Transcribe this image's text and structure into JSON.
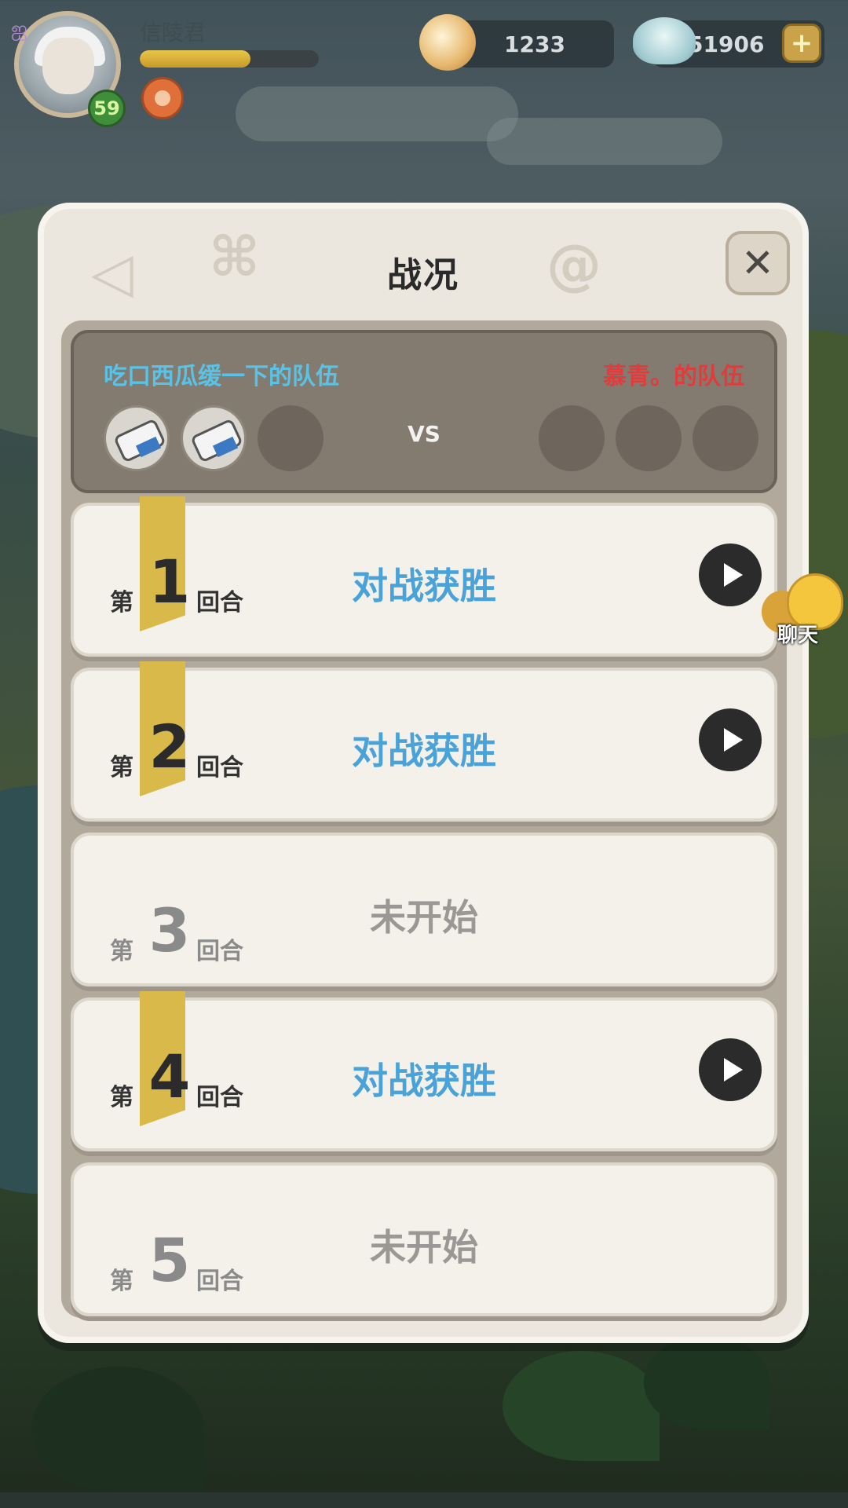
{
  "player": {
    "name": "信陵君",
    "level": "59",
    "exp_fraction": 0.62
  },
  "resources": {
    "pearls": "1233",
    "shells": "251906",
    "add_label": "+"
  },
  "dialog": {
    "title": "战况",
    "close_label": "✕",
    "team_left": "吃口西瓜缓一下的队伍",
    "team_right": "慕青。的队伍",
    "vs_label": "VS",
    "rounds": [
      {
        "prefix": "第",
        "number": "1",
        "suffix": "回合",
        "status": "对战获胜",
        "state": "won"
      },
      {
        "prefix": "第",
        "number": "2",
        "suffix": "回合",
        "status": "对战获胜",
        "state": "won"
      },
      {
        "prefix": "第",
        "number": "3",
        "suffix": "回合",
        "status": "未开始",
        "state": "pending"
      },
      {
        "prefix": "第",
        "number": "4",
        "suffix": "回合",
        "status": "对战获胜",
        "state": "won"
      },
      {
        "prefix": "第",
        "number": "5",
        "suffix": "回合",
        "status": "未开始",
        "state": "pending"
      }
    ]
  },
  "chat": {
    "label": "聊天"
  },
  "colors": {
    "win_text": "#4aa3d8",
    "pending_text": "#9a9894",
    "team_left": "#58c3e6",
    "team_right": "#e23b3b",
    "ribbon": "#d8b94a"
  },
  "icons": {
    "avatar": "player-avatar",
    "pearl": "pearl-icon",
    "shell": "shell-icon",
    "play": "play-icon",
    "close": "close-icon",
    "chat": "chat-icon"
  }
}
